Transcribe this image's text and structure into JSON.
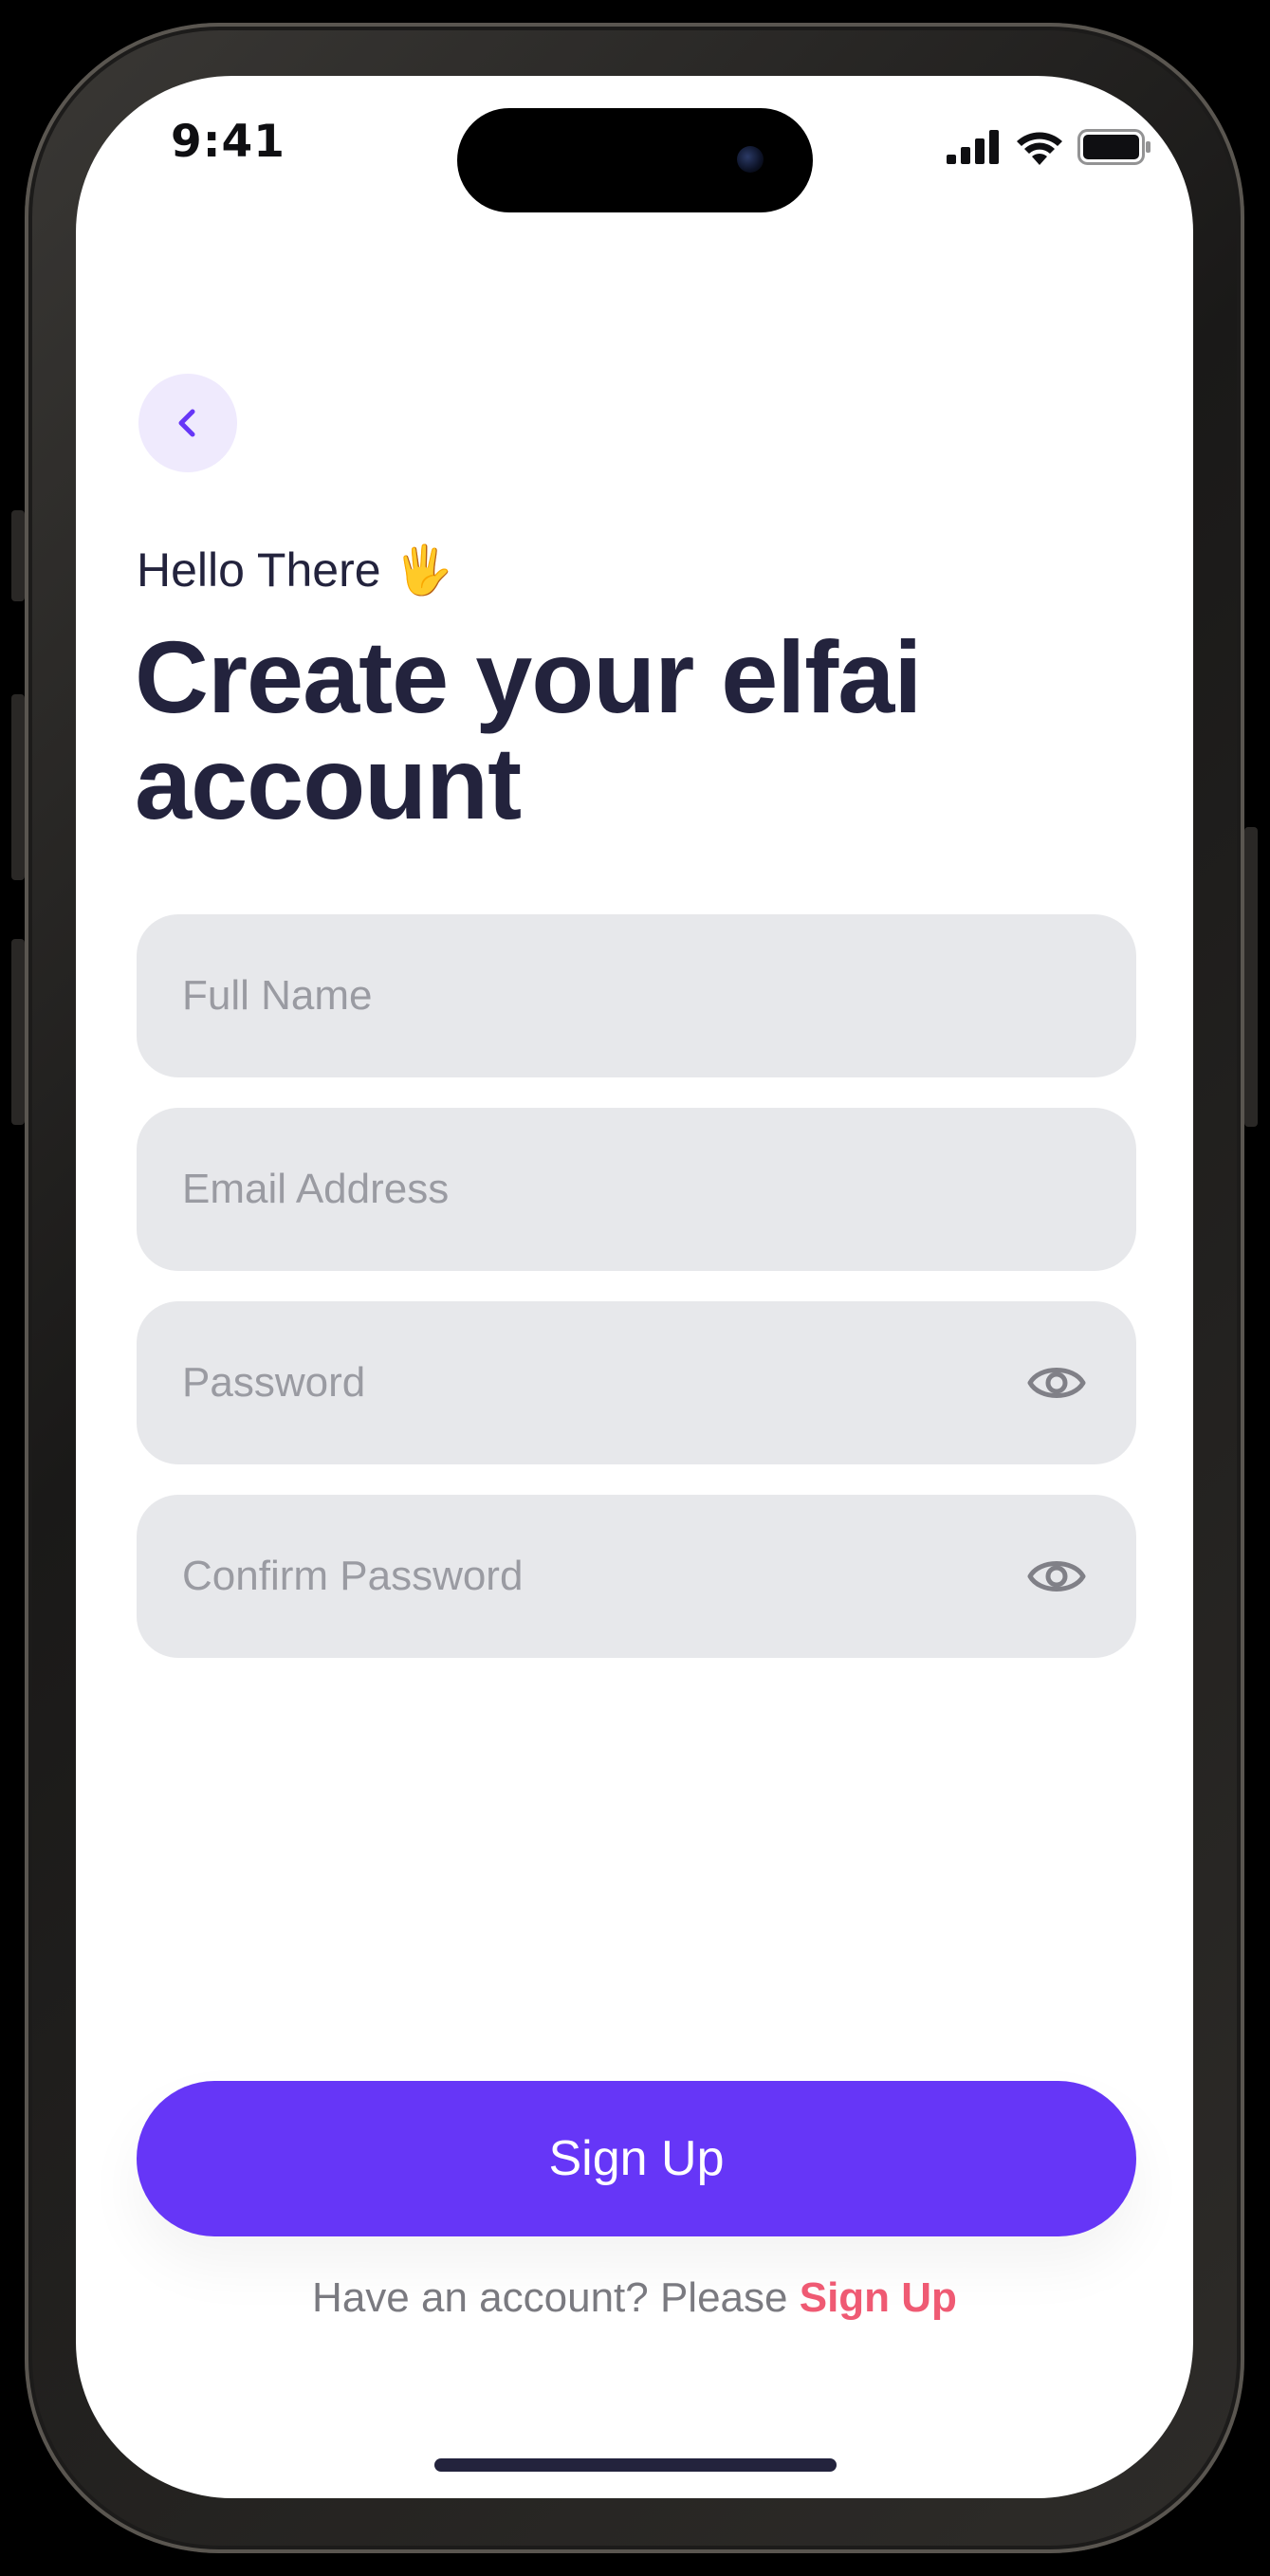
{
  "status_bar": {
    "time": "9:41"
  },
  "header": {
    "greeting": "Hello There",
    "greeting_emoji": "🖐",
    "title": "Create your elfai account"
  },
  "form": {
    "full_name_placeholder": "Full Name",
    "email_placeholder": "Email Address",
    "password_placeholder": "Password",
    "confirm_password_placeholder": "Confirm Password"
  },
  "actions": {
    "signup_label": "Sign Up",
    "footer_prompt": "Have an account? Please",
    "footer_link": "Sign Up"
  },
  "colors": {
    "accent": "#6636f7",
    "link": "#ef5a73",
    "text_dark": "#23233d",
    "field_bg": "#e7e8eb"
  },
  "icons": [
    "chevron-left-icon",
    "eye-icon",
    "signal-icon",
    "wifi-icon",
    "battery-icon"
  ]
}
